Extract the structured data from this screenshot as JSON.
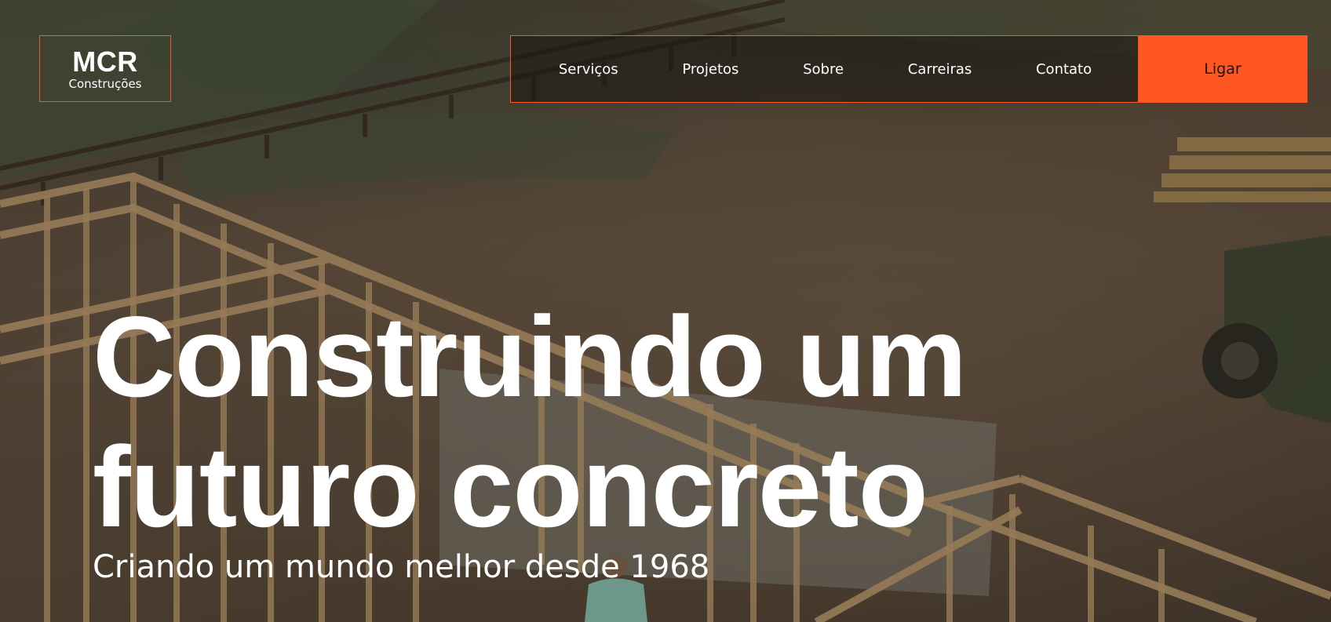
{
  "logo": {
    "title": "MCR",
    "subtitle": "Construções"
  },
  "nav": {
    "links": [
      "Serviços",
      "Projetos",
      "Sobre",
      "Carreiras",
      "Contato"
    ],
    "cta_label": "Ligar"
  },
  "hero": {
    "headline_line1": "Construindo um",
    "headline_line2": "futuro concreto",
    "tagline": "Criando um mundo melhor desde 1968"
  },
  "colors": {
    "accent": "#ff5722",
    "text": "#ffffff"
  }
}
